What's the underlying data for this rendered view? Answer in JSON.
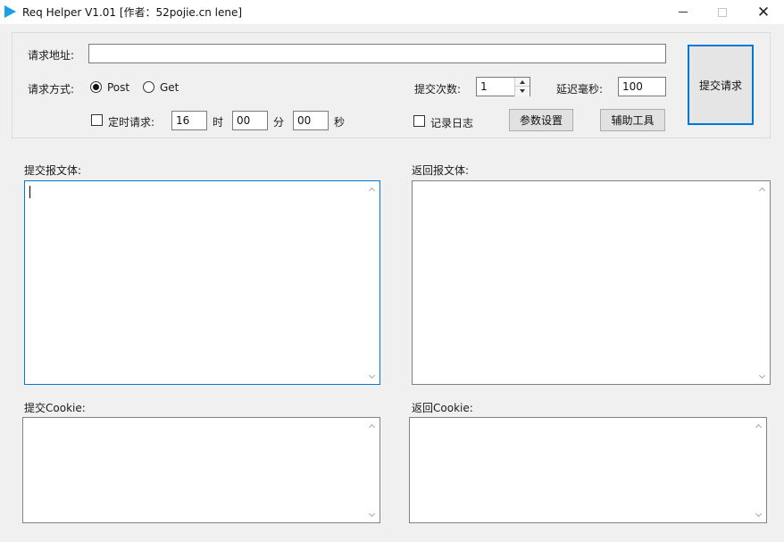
{
  "window": {
    "title": "Req Helper V1.01    [作者：52pojie.cn lene]",
    "minimize": "",
    "maximize": "",
    "close": "✕"
  },
  "request": {
    "url_label": "请求地址:",
    "url_value": "",
    "method_label": "请求方式:",
    "methods": [
      {
        "label": "Post",
        "selected": true
      },
      {
        "label": "Get",
        "selected": false
      }
    ],
    "count_label": "提交次数:",
    "count_value": "1",
    "delay_label": "延迟毫秒:",
    "delay_value": "100",
    "submit_label": "提交请求",
    "timer_label": "定时请求:",
    "hour_value": "16",
    "hour_unit": "时",
    "minute_value": "00",
    "minute_unit": "分",
    "second_value": "00",
    "second_unit": "秒",
    "log_label": "记录日志",
    "params_button": "参数设置",
    "tools_button": "辅助工具"
  },
  "panes": {
    "submit_body_label": "提交报文体:",
    "response_body_label": "返回报文体:",
    "submit_cookie_label": "提交Cookie:",
    "response_cookie_label": "返回Cookie:"
  }
}
